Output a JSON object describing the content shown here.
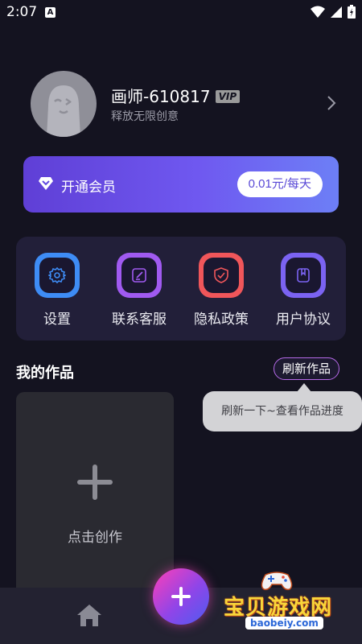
{
  "status_bar": {
    "time": "2:07",
    "notif_letter": "A"
  },
  "profile": {
    "name": "画师-610817",
    "vip_badge": "VIP",
    "subtitle": "释放无限创意"
  },
  "vip_card": {
    "title": "开通会员",
    "price_button": "0.01元/每天"
  },
  "settings": {
    "items": [
      {
        "label": "设置",
        "icon": "gear-icon",
        "color": "#3e8cf5"
      },
      {
        "label": "联系客服",
        "icon": "edit-note-icon",
        "color": "#a05af0"
      },
      {
        "label": "隐私政策",
        "icon": "shield-check-icon",
        "color": "#f0565a"
      },
      {
        "label": "用户协议",
        "icon": "bookmark-doc-icon",
        "color": "#7b63f2"
      }
    ]
  },
  "works": {
    "title": "我的作品",
    "refresh_button": "刷新作品",
    "tooltip": "刷新一下~查看作品进度",
    "create_label": "点击创作"
  },
  "bottom_nav": {
    "home_icon": "home-icon",
    "fab_icon": "plus-icon"
  },
  "watermark": {
    "text": "宝贝游戏网",
    "url": "baobeiy.com"
  }
}
